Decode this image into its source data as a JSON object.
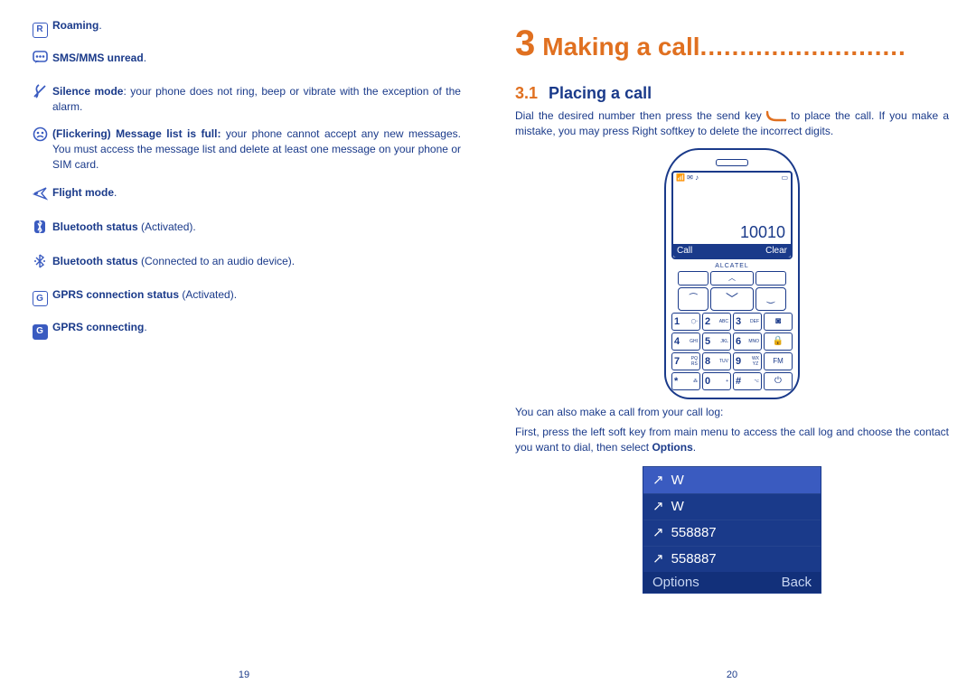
{
  "left": {
    "items": [
      {
        "bold": "Roaming",
        "rest": "."
      },
      {
        "bold": "SMS/MMS unread",
        "rest": "."
      },
      {
        "bold": "Silence mode",
        "rest": ": your phone does not ring, beep or vibrate with the exception of the alarm."
      },
      {
        "bold": "(Flickering) Message list is full:",
        "rest": " your phone cannot accept any new messages. You must access the message list and delete at least one message on your phone or SIM card."
      },
      {
        "bold": "Flight mode",
        "rest": "."
      },
      {
        "bold": "Bluetooth status",
        "rest": " (Activated)."
      },
      {
        "bold": "Bluetooth status",
        "rest": " (Connected to an audio device)."
      },
      {
        "bold": "GPRS connection status",
        "rest": " (Activated)."
      },
      {
        "bold": "GPRS connecting",
        "rest": "."
      }
    ],
    "page_num": "19"
  },
  "right": {
    "chapter_num": "3",
    "chapter_title": "Making a call",
    "chapter_dots": "..........................",
    "section_num": "3.1",
    "section_title": "Placing a call",
    "para1_a": "Dial the desired number then press the send key ",
    "para1_b": " to place the call. If you make a mistake, you may press Right softkey to delete the incorrect digits.",
    "phone": {
      "display_number": "10010",
      "soft_left": "Call",
      "soft_right": "Clear",
      "brand": "ALCATEL",
      "keys": [
        [
          "1",
          "◯▫"
        ],
        [
          "2",
          "ABC"
        ],
        [
          "3",
          "DEF"
        ],
        [
          "icon",
          "📷"
        ],
        [
          "4",
          "GHI"
        ],
        [
          "5",
          "JKL"
        ],
        [
          "6",
          "MNO"
        ],
        [
          "icon",
          "🔒"
        ],
        [
          "7",
          "PQRS"
        ],
        [
          "8",
          "TUV"
        ],
        [
          "9",
          "WXYZ"
        ],
        [
          "icon",
          "FM"
        ],
        [
          "*",
          "⁂"
        ],
        [
          "0",
          "+"
        ],
        [
          "#",
          "⌥"
        ],
        [
          "icon",
          "⏻"
        ]
      ]
    },
    "para2": "You can also make a call from your call log:",
    "para3_a": "First, press the left soft key from main menu to access the call log and choose the contact you want to dial, then select ",
    "para3_b": "Options",
    "para3_c": ".",
    "calllog": {
      "rows": [
        "W",
        "W",
        "558887",
        "558887"
      ],
      "left": "Options",
      "right": "Back"
    },
    "page_num": "20"
  }
}
